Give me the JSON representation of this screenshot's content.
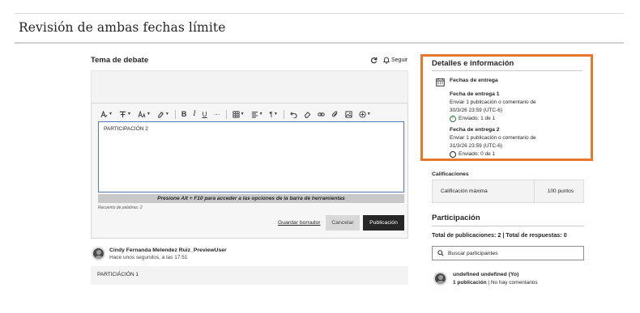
{
  "page": {
    "title": "Revisión de ambas fechas límite"
  },
  "topic": {
    "label": "Tema de debate",
    "follow_label": "Seguir"
  },
  "editor": {
    "toolbar": {
      "paragraph_menu": "¶",
      "bold": "B",
      "italic": "I",
      "underline": "U",
      "more": "···"
    },
    "content": "PARTICIPACIÓN 2",
    "hint": "Presione Alt + F10 para acceder a las opciones de la barra de herramientas",
    "word_count": "Recuento de palabras: 2",
    "save_draft": "Guardar borrador",
    "cancel": "Cancelar",
    "publish": "Publicación"
  },
  "post": {
    "author": "Cindy Fernanda Melendez Ruiz_PreviewUser",
    "time": "Hace unos segundos, a las 17:51",
    "body": "PARTICIÁCIÓN 1"
  },
  "details": {
    "title": "Detalles e información",
    "due_heading": "Fechas de entrega",
    "due1": {
      "title": "Fecha de entrega 1",
      "line1": "Enviar 1 publicación o comentario de",
      "line2": "30/3/26 23:59 (UTC-6)",
      "status": "Enviado: 1 de 1"
    },
    "due2": {
      "title": "Fecha de entrega 2",
      "line1": "Enviar 1 publicación o comentario de",
      "line2": "31/3/26 23:59 (UTC-6)",
      "status": "Enviado: 0 de 1"
    }
  },
  "grading": {
    "label": "Calificaciones",
    "max_label": "Calificación máxima",
    "max_value": "100 puntos"
  },
  "participation": {
    "title": "Participación",
    "totals": "Total de publicaciones: 2 | Total de respuestas: 0",
    "search_placeholder": "Buscar participantes",
    "participant": {
      "name": "undefined undefined (Yo)",
      "posts": "1 publicación",
      "comments": "No hay comentarios"
    }
  }
}
